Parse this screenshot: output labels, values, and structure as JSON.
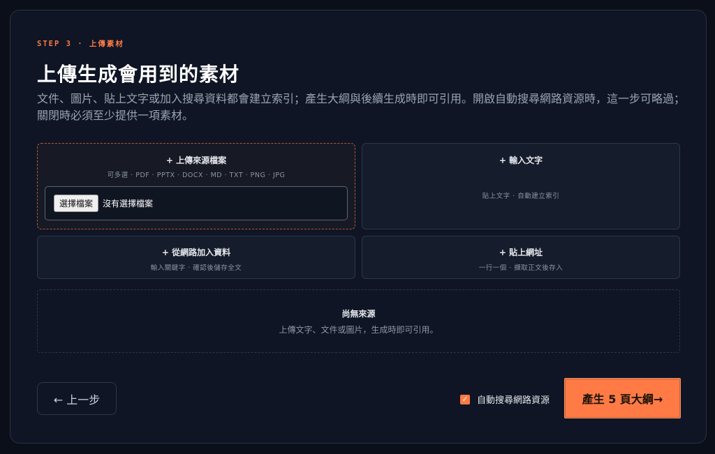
{
  "step": "STEP 3 · 上傳素材",
  "title": "上傳生成會用到的素材",
  "description": "文件、圖片、貼上文字或加入搜尋資料都會建立索引；產生大綱與後續生成時即可引用。開啟自動搜尋網路資源時，這一步可略過；關閉時必須至少提供一項素材。",
  "upload": {
    "title": "+ 上傳來源檔案",
    "formats": "可多選 · PDF · PPTX · DOCX · MD · TXT · PNG · JPG",
    "choose_label": "選擇檔案",
    "no_file": "沒有選擇檔案"
  },
  "text_input": {
    "title": "+ 輸入文字",
    "sub": "貼上文字 · 自動建立索引"
  },
  "web_search": {
    "title": "+ 從網路加入資料",
    "sub": "輸入關鍵字 · 確認後儲存全文"
  },
  "url_input": {
    "title": "+ 貼上網址",
    "sub": "一行一個 · 擷取正文後存入"
  },
  "empty": {
    "title": "尚無來源",
    "sub": "上傳文字、文件或圖片，生成時即可引用。"
  },
  "back_label": "← 上一步",
  "auto_search_label": "自動搜尋網路資源",
  "auto_search_checked": true,
  "generate_label": "產生 5 頁大綱→",
  "colors": {
    "accent": "#ff7a45",
    "background": "#0b0f19",
    "card": "#0f1524"
  }
}
